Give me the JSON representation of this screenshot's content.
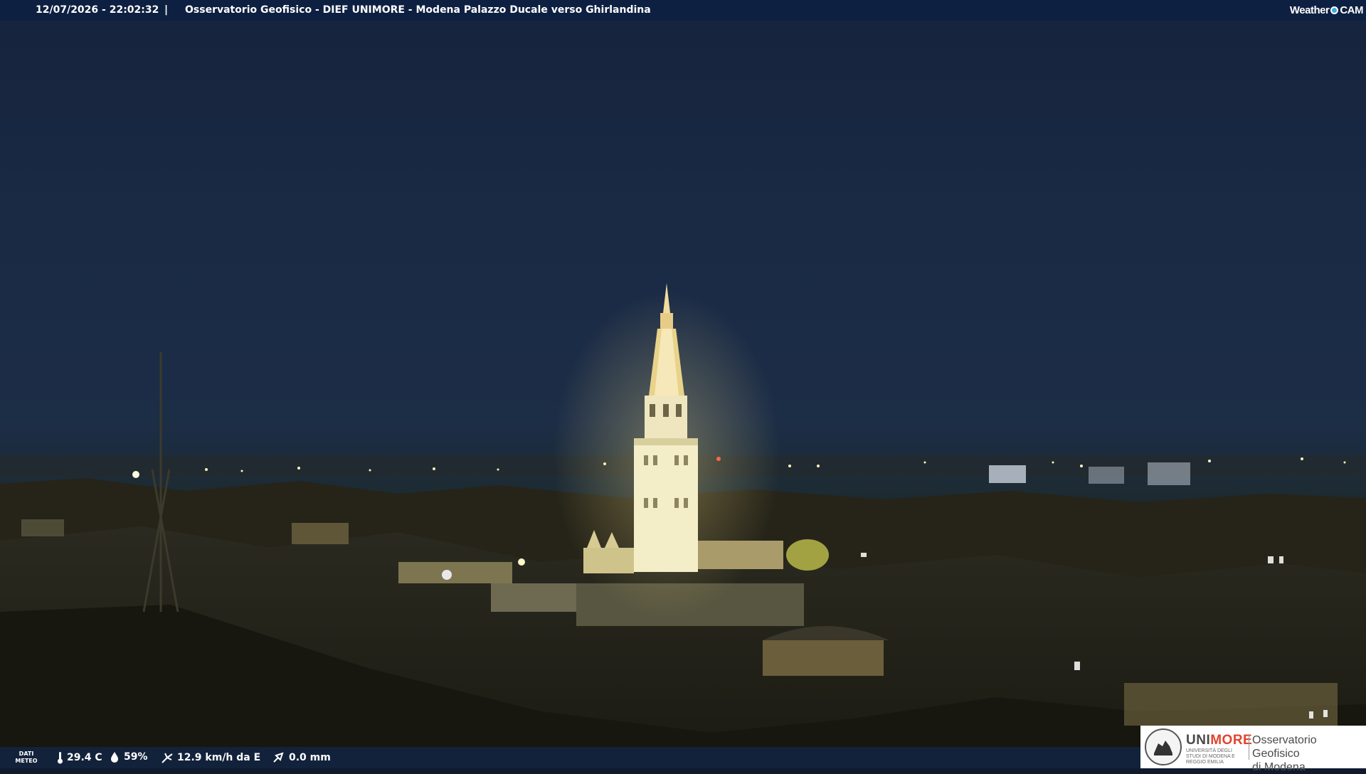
{
  "header": {
    "datetime": "12/07/2026 - 22:02:32",
    "separator": "|",
    "title": "Osservatorio Geofisico - DIEF UNIMORE - Modena Palazzo Ducale verso Ghirlandina"
  },
  "brand": {
    "left": "Weather",
    "right": "CAM"
  },
  "weather": {
    "label_line1": "DATI",
    "label_line2": "METEO",
    "temperature": "29.4 C",
    "humidity": "59%",
    "wind": "12.9 km/h da E",
    "rain": "0.0 mm",
    "icons": [
      "thermometer-icon",
      "humidity-drop-icon",
      "wind-icon",
      "rain-gauge-icon"
    ]
  },
  "logo": {
    "unimore_a": "UNI",
    "unimore_b": "MORE",
    "unimore_sub": "UNIVERSITÀ DEGLI STUDI DI MODENA E REGGIO EMILIA",
    "observatory_line1": "Osservatorio Geofisico",
    "observatory_line2": "di Modena"
  },
  "colors": {
    "bar": "#0e2042",
    "accent_red": "#e2452e",
    "brand_blue": "#39a9e0",
    "tower_light": "#f4eec8"
  }
}
